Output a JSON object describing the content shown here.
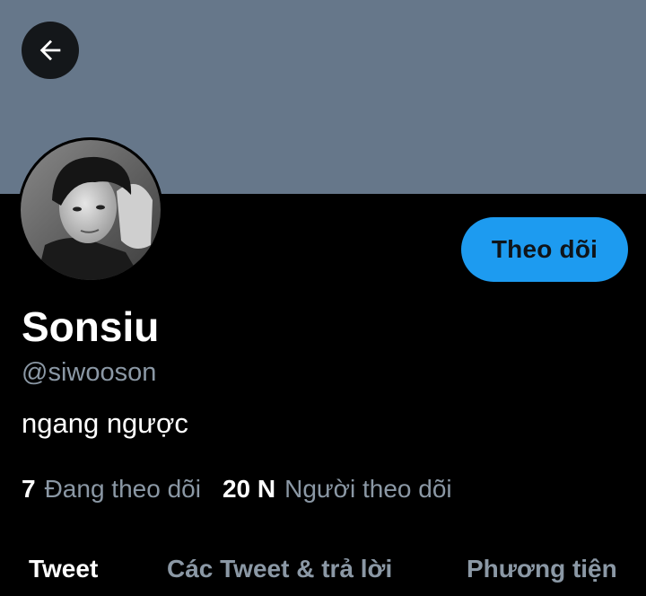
{
  "header": {
    "banner_color": "#66778a",
    "back_icon": "arrow-left-icon"
  },
  "profile": {
    "display_name": "Sonsiu",
    "handle": "@siwooson",
    "bio": "ngang ngược",
    "follow_label": "Theo dõi",
    "accent_color": "#1d9bf0"
  },
  "stats": {
    "following_count": "7",
    "following_label": "Đang theo dõi",
    "followers_count": "20 N",
    "followers_label": "Người theo dõi"
  },
  "tabs": [
    {
      "label": "Tweet",
      "active": true
    },
    {
      "label": "Các Tweet & trả lời",
      "active": false
    },
    {
      "label": "Phương tiện",
      "active": false
    }
  ]
}
